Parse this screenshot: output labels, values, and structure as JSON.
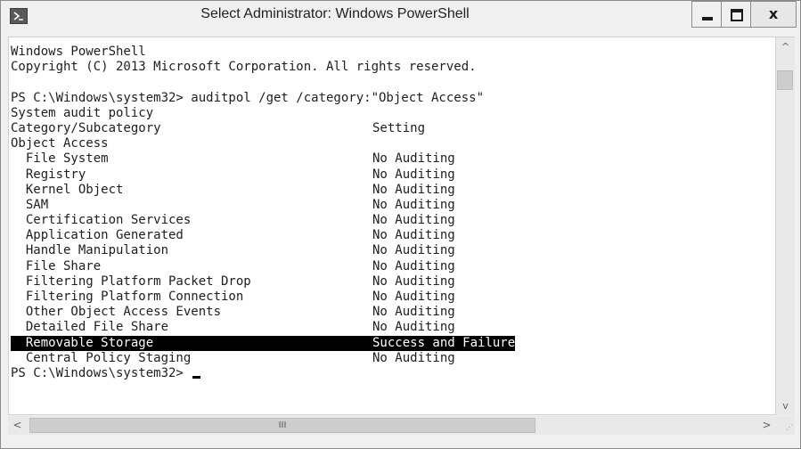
{
  "window": {
    "title": "Select Administrator: Windows PowerShell",
    "close_label": "x"
  },
  "console": {
    "intro_lines": [
      "Windows PowerShell",
      "Copyright (C) 2013 Microsoft Corporation. All rights reserved.",
      "",
      "PS C:\\Windows\\system32> auditpol /get /category:\"Object Access\"",
      "System audit policy"
    ],
    "header": {
      "subcategory": "Category/Subcategory",
      "setting": "Setting"
    },
    "category": "Object Access",
    "rows": [
      {
        "subcategory": "  File System",
        "setting": "No Auditing"
      },
      {
        "subcategory": "  Registry",
        "setting": "No Auditing"
      },
      {
        "subcategory": "  Kernel Object",
        "setting": "No Auditing"
      },
      {
        "subcategory": "  SAM",
        "setting": "No Auditing"
      },
      {
        "subcategory": "  Certification Services",
        "setting": "No Auditing"
      },
      {
        "subcategory": "  Application Generated",
        "setting": "No Auditing"
      },
      {
        "subcategory": "  Handle Manipulation",
        "setting": "No Auditing"
      },
      {
        "subcategory": "  File Share",
        "setting": "No Auditing"
      },
      {
        "subcategory": "  Filtering Platform Packet Drop",
        "setting": "No Auditing"
      },
      {
        "subcategory": "  Filtering Platform Connection",
        "setting": "No Auditing"
      },
      {
        "subcategory": "  Other Object Access Events",
        "setting": "No Auditing"
      },
      {
        "subcategory": "  Detailed File Share",
        "setting": "No Auditing"
      },
      {
        "subcategory": "  Removable Storage",
        "setting": "Success and Failure",
        "highlighted": true
      },
      {
        "subcategory": "  Central Policy Staging",
        "setting": "No Auditing"
      }
    ],
    "prompt": "PS C:\\Windows\\system32> "
  },
  "scrollbars": {
    "up_arrow": "^",
    "down_arrow": "v",
    "left_arrow": "<",
    "right_arrow": ">",
    "h_thumb_grip": "III"
  },
  "colors": {
    "selection_bg": "#000000",
    "selection_fg": "#ffffff",
    "console_bg": "#ffffff",
    "chrome_bg": "#f0f0f0"
  }
}
